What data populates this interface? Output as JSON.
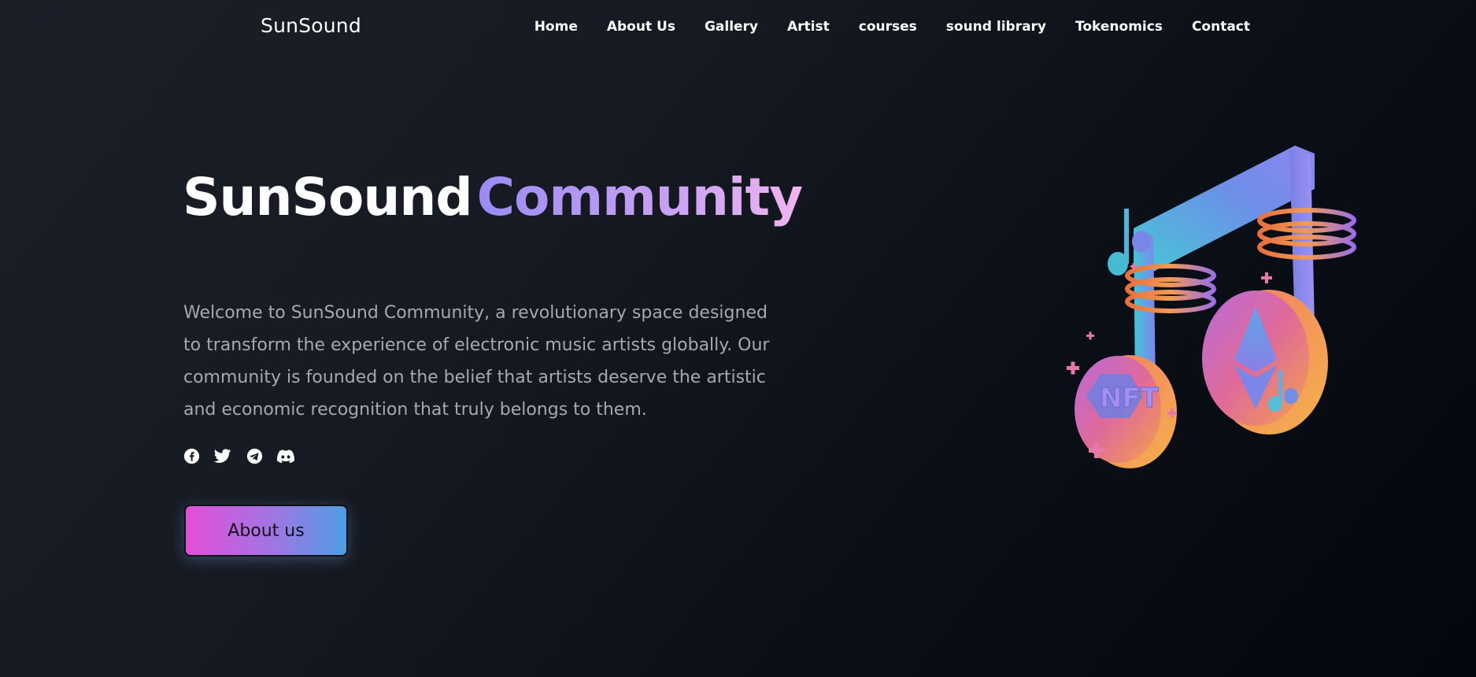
{
  "nav": {
    "brand": "SunSound",
    "links": [
      "Home",
      "About Us",
      "Gallery",
      "Artist",
      "courses",
      "sound library",
      "Tokenomics",
      "Contact"
    ]
  },
  "hero": {
    "title_primary": "SunSound",
    "title_accent": "Community",
    "description": "Welcome to SunSound Community, a revolutionary space designed to transform the experience of electronic music artists globally. Our community is founded on the belief that artists deserve the artistic and economic recognition that truly belongs to them.",
    "cta_label": "About us",
    "socials": [
      "facebook-icon",
      "twitter-icon",
      "telegram-icon",
      "discord-icon"
    ],
    "illustration_badge": "NFT"
  },
  "colors": {
    "accent_gradient_start": "#9a8bf4",
    "accent_gradient_end": "#f0b4f0",
    "button_gradient_start": "#e34fd6",
    "button_gradient_end": "#4e9ee4",
    "background": "#161a22"
  }
}
